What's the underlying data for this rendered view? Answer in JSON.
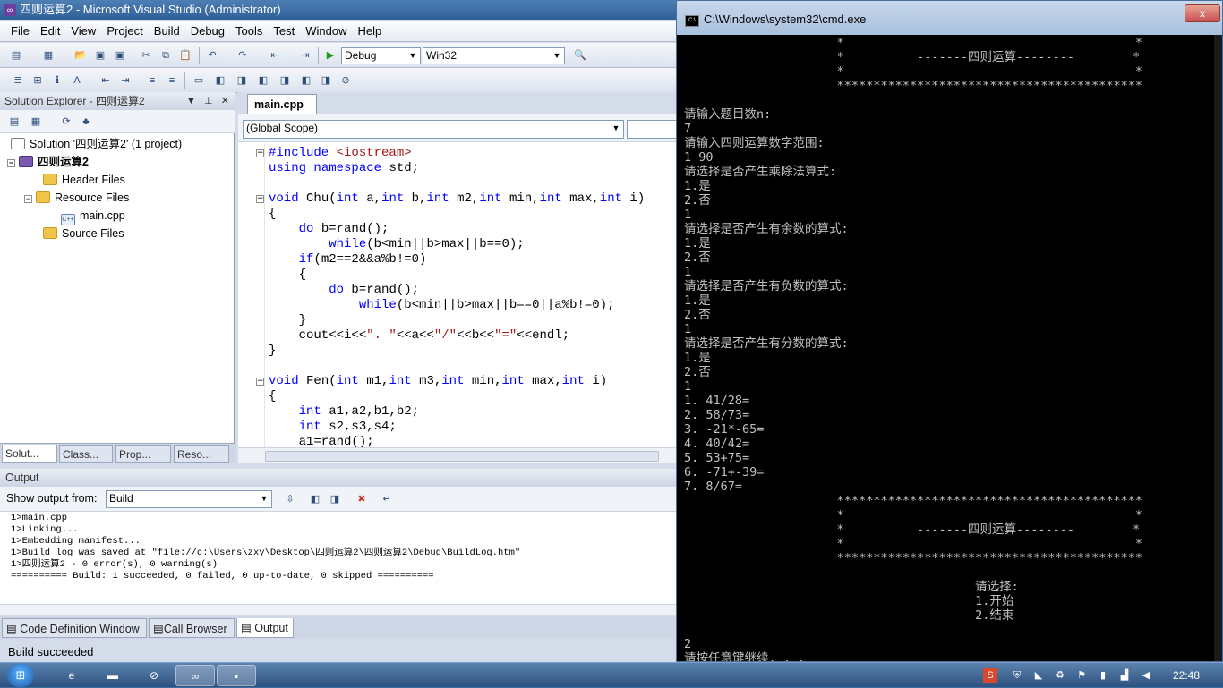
{
  "vs": {
    "title": "四则运算2 - Microsoft Visual Studio (Administrator)",
    "menu": [
      "File",
      "Edit",
      "View",
      "Project",
      "Build",
      "Debug",
      "Tools",
      "Test",
      "Window",
      "Help"
    ],
    "toolbar": {
      "config": "Debug",
      "platform": "Win32"
    },
    "solution_explorer": {
      "title": "Solution Explorer - 四则运算2",
      "solution": "Solution '四则运算2' (1 project)",
      "project": "四则运算2",
      "header_files": "Header Files",
      "resource_files": "Resource Files",
      "main_cpp": "main.cpp",
      "source_files": "Source Files",
      "tabs": [
        "Solut...",
        "Class...",
        "Prop...",
        "Reso..."
      ]
    },
    "editor": {
      "tab": "main.cpp",
      "scope": "(Global Scope)",
      "lines": [
        "#include <iostream>",
        "using namespace std;",
        "",
        "void Chu(int a,int b,int m2,int min,int max,int i)",
        "{",
        "    do b=rand();",
        "        while(b<min||b>max||b==0);",
        "    if(m2==2&&a%b!=0)",
        "    {",
        "        do b=rand();",
        "            while(b<min||b>max||b==0||a%b!=0);",
        "    }",
        "    cout<<i<<\". \"<<a<<\"/\"<<b<<\"=\"<<endl;",
        "}",
        "",
        "void Fen(int m1,int m3,int min,int max,int i)",
        "{",
        "    int a1,a2,b1,b2;",
        "    int s2,s3,s4;",
        "    a1=rand();"
      ]
    },
    "output": {
      "title": "Output",
      "show_from_label": "Show output from:",
      "source": "Build",
      "lines": [
        "1>main.cpp",
        "1>Linking...",
        "1>Embedding manifest...",
        "1>Build log was saved at \"file://c:\\Users\\zxy\\Desktop\\四则运算2\\四则运算2\\Debug\\BuildLog.htm\"",
        "1>四则运算2 - 0 error(s), 0 warning(s)",
        "========== Build: 1 succeeded, 0 failed, 0 up-to-date, 0 skipped =========="
      ]
    },
    "bottom_tabs": [
      "Code Definition Window",
      "Call Browser",
      "Output"
    ],
    "status": "Build succeeded"
  },
  "cmd": {
    "title": "C:\\Windows\\system32\\cmd.exe",
    "close_label": "x",
    "lines": [
      "                     *                                        *",
      "                     *          -------四则运算--------        *",
      "                     *                                        *",
      "                     ******************************************",
      "",
      "请输入题目数n:",
      "7",
      "请输入四则运算数字范围:",
      "1 90",
      "请选择是否产生乘除法算式:",
      "1.是",
      "2.否",
      "1",
      "请选择是否产生有余数的算式:",
      "1.是",
      "2.否",
      "1",
      "请选择是否产生有负数的算式:",
      "1.是",
      "2.否",
      "1",
      "请选择是否产生有分数的算式:",
      "1.是",
      "2.否",
      "1",
      "1. 41/28=",
      "2. 58/73=",
      "3. -21*-65=",
      "4. 40/42=",
      "5. 53+75=",
      "6. -71+-39=",
      "7. 8/67=",
      "                     ******************************************",
      "                     *                                        *",
      "                     *          -------四则运算--------        *",
      "                     *                                        *",
      "                     ******************************************",
      "",
      "                                        请选择:",
      "                                        1.开始",
      "                                        2.结束",
      "",
      "2",
      "请按任意键继续. . . _"
    ]
  },
  "taskbar": {
    "time": "22:48"
  }
}
